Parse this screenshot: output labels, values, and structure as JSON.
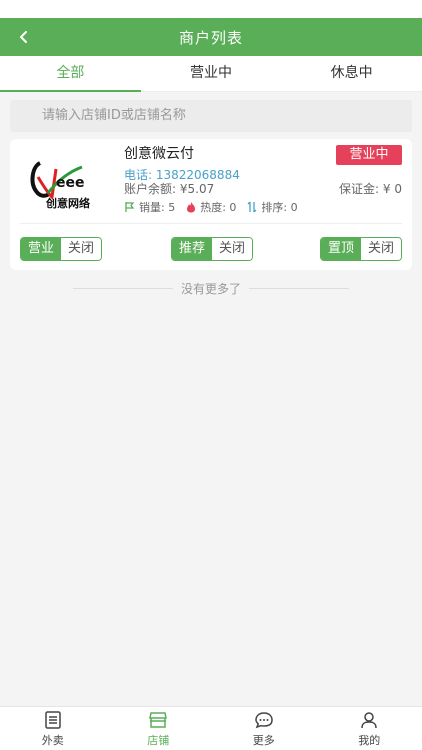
{
  "header": {
    "title": "商户列表"
  },
  "tabs": [
    {
      "label": "全部",
      "active": true
    },
    {
      "label": "营业中",
      "active": false
    },
    {
      "label": "休息中",
      "active": false
    }
  ],
  "search": {
    "placeholder": "请输入店铺ID或店铺名称"
  },
  "shop": {
    "logo_text": "Ceee 创意网络",
    "name": "创意微云付",
    "status": "营业中",
    "phone": "电话: 13822068884",
    "balance": "账户余额: ¥5.07",
    "deposit": "保证金: ¥ 0",
    "stats": {
      "sales": "销量: 5",
      "heat": "热度: 0",
      "sort": "排序: 0"
    },
    "toggles": [
      {
        "on": "营业",
        "off": "关闭"
      },
      {
        "on": "推荐",
        "off": "关闭"
      },
      {
        "on": "置顶",
        "off": "关闭"
      }
    ]
  },
  "footer_text": "没有更多了",
  "bottom_nav": [
    {
      "label": "外卖",
      "icon": "list-icon",
      "active": false
    },
    {
      "label": "店铺",
      "icon": "store-icon",
      "active": true
    },
    {
      "label": "更多",
      "icon": "chat-icon",
      "active": false
    },
    {
      "label": "我的",
      "icon": "user-icon",
      "active": false
    }
  ],
  "colors": {
    "brand": "#5aae57",
    "status_badge": "#e5415a",
    "phone": "#4aa0c8"
  }
}
